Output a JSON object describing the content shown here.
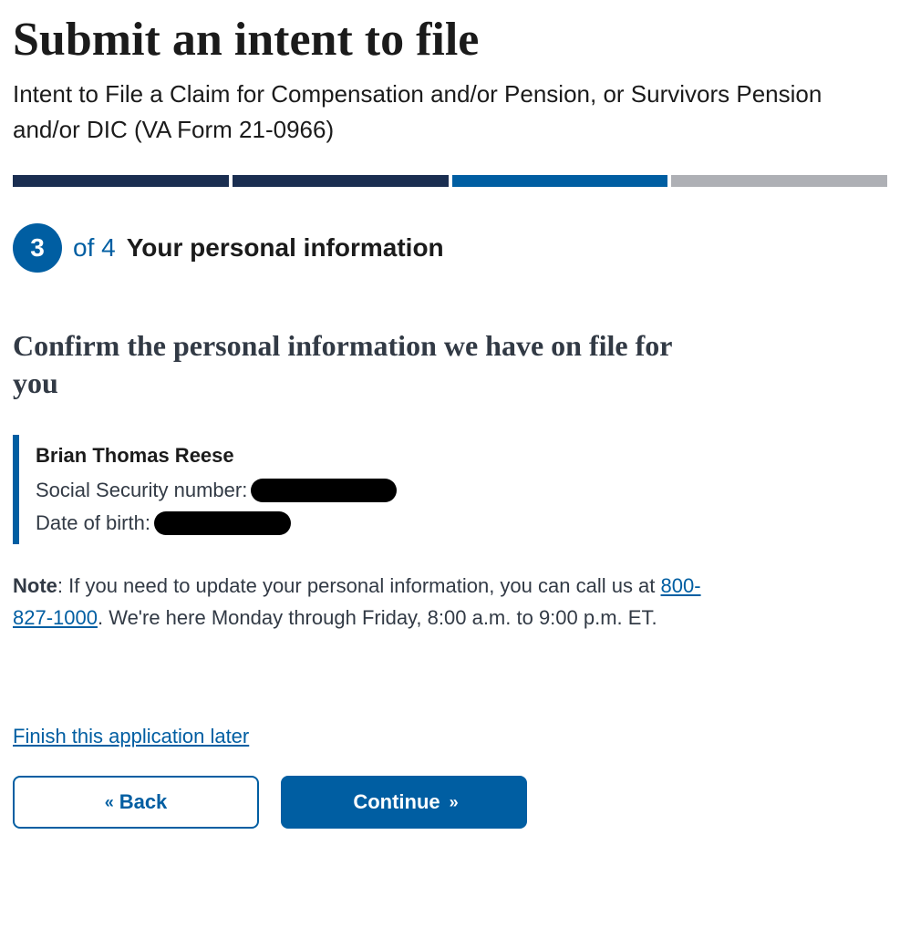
{
  "header": {
    "title": "Submit an intent to file",
    "subtitle": "Intent to File a Claim for Compensation and/or Pension, or Survivors Pension and/or DIC (VA Form 21-0966)"
  },
  "progress": {
    "current_step": "3",
    "total_steps": "4",
    "of_text": "of 4",
    "step_title": "Your personal information"
  },
  "section": {
    "heading": "Confirm the personal information we have on file for you"
  },
  "personal": {
    "name": "Brian Thomas Reese",
    "ssn_label": "Social Security number:",
    "dob_label": "Date of birth:"
  },
  "note": {
    "label": "Note",
    "text_before": ": If you need to update your personal information, you can call us at ",
    "phone": "800-827-1000",
    "text_after": ". We're here Monday through Friday, 8:00 a.m. to 9:00 p.m. ET."
  },
  "actions": {
    "finish_later": "Finish this application later",
    "back": "Back",
    "continue": "Continue"
  }
}
